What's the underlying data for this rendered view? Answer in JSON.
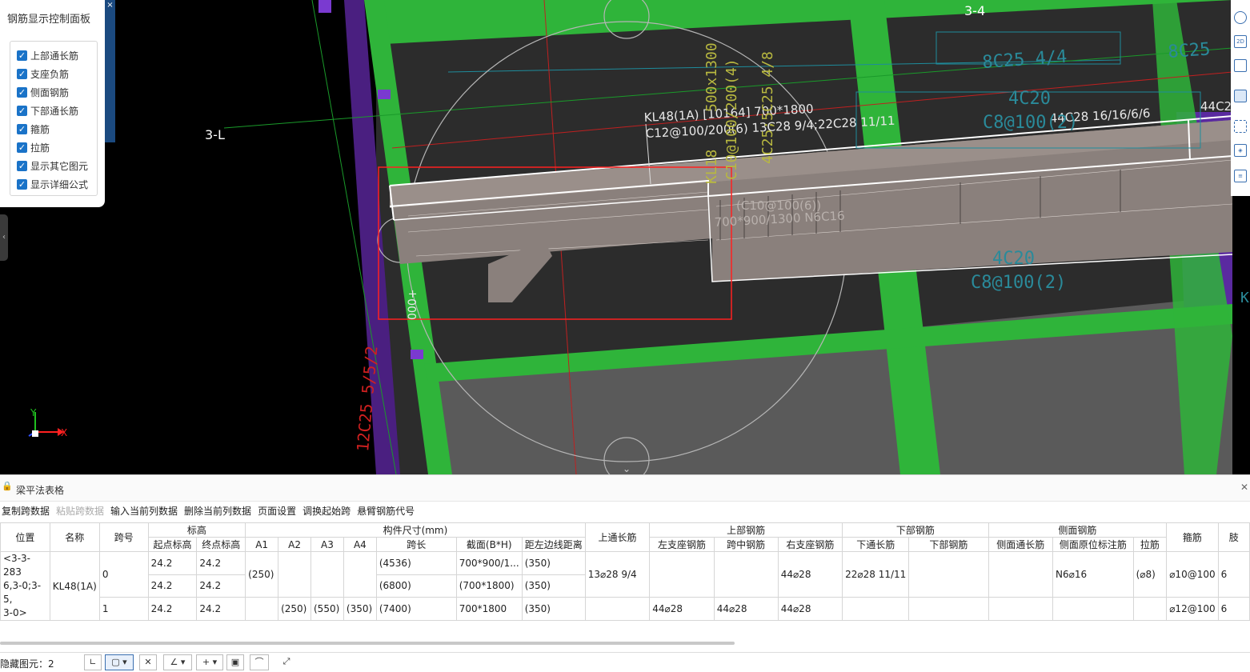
{
  "viewport": {
    "grid_labels": {
      "left_axis": "3-L",
      "top_axis": "3-4"
    },
    "annotations": {
      "beam_name": "KL48(1A) [10164] 700*1800",
      "beam_rebar": "C12@100/200(6) 13C28 9/4;22C28 11/11",
      "rebar_top_right": "8C25 4/4",
      "rebar_top_far": "8C25",
      "count_4c20": "4C20",
      "stirrup_c8_top": "C8@100(2)",
      "rebar_44c28": "44C28 16/16/6/6",
      "rebar_44c2_cut": "44C2",
      "stirrup_inner": "(C10@100(6))",
      "section_inner": "700*900/1300 N6C16",
      "stirrup_c8_bottom": "C8@100(2)",
      "count_4c20_bottom": "4C20",
      "vertical_kl": "KL18",
      "vertical_size": "500x1300",
      "vertical_stirrup": "C10@100/200(4)",
      "vertical_rebar": "4C25;5C25 4/8",
      "rebar_left_side": "12C25 5/5/2",
      "dim_label": "000+",
      "right_edge_char": "K"
    },
    "axes_indicator": {
      "y": "Y",
      "x": "X"
    },
    "colors": {
      "beam_green": "#2fb43a",
      "column_purple": "#6a2bb0",
      "selection_red": "#ff2020",
      "background": "#000000",
      "slab_gray": "#2c2c2c"
    }
  },
  "control_panel": {
    "title": "钢筋显示控制面板",
    "options": [
      {
        "label": "上部通长筋",
        "checked": true
      },
      {
        "label": "支座负筋",
        "checked": true
      },
      {
        "label": "侧面钢筋",
        "checked": true
      },
      {
        "label": "下部通长筋",
        "checked": true
      },
      {
        "label": "箍筋",
        "checked": true
      },
      {
        "label": "拉筋",
        "checked": true
      },
      {
        "label": "显示其它图元",
        "checked": true
      },
      {
        "label": "显示详细公式",
        "checked": true
      }
    ],
    "close_glyph": "×"
  },
  "right_toolbar": {
    "icons": [
      "orbit-icon",
      "2d-view-icon",
      "box-view-icon",
      "cube-view-icon",
      "fit-view-icon",
      "3d-box-icon",
      "formula-icon"
    ],
    "labels": {
      "2d": "2D"
    }
  },
  "table_panel": {
    "title": "梁平法表格",
    "toolbar": [
      {
        "label": "复制跨数据",
        "enabled": true
      },
      {
        "label": "粘贴跨数据",
        "enabled": false
      },
      {
        "label": "输入当前列数据",
        "enabled": true
      },
      {
        "label": "删除当前列数据",
        "enabled": true
      },
      {
        "label": "页面设置",
        "enabled": true
      },
      {
        "label": "调换起始跨",
        "enabled": true
      },
      {
        "label": "悬臂钢筋代号",
        "enabled": true
      }
    ],
    "headers": {
      "position": "位置",
      "name": "名称",
      "span_no": "跨号",
      "elevation": "标高",
      "elev_start": "起点标高",
      "elev_end": "终点标高",
      "dimensions": "构件尺寸(mm)",
      "a1": "A1",
      "a2": "A2",
      "a3": "A3",
      "a4": "A4",
      "span_len": "跨长",
      "section": "截面(B*H)",
      "edge_dist": "距左边线距离",
      "top_cont": "上通长筋",
      "top_rebar": "上部钢筋",
      "left_support": "左支座钢筋",
      "mid_span": "跨中钢筋",
      "right_support": "右支座钢筋",
      "bottom_rebar": "下部钢筋",
      "bottom_cont": "下通长筋",
      "bottom_bar": "下部钢筋",
      "side_rebar": "侧面钢筋",
      "side_cont": "侧面通长筋",
      "side_orig": "侧面原位标注筋",
      "tie": "拉筋",
      "stirrup": "箍筋",
      "limbs": "肢"
    },
    "rows": [
      {
        "position": "<3-3-283\n6,3-0;3-5,\n3-0>",
        "name": "KL48(1A)",
        "span": "0",
        "elev_start": "24.2",
        "elev_end": "24.2",
        "a1": "(250)",
        "a2": "",
        "a3": "",
        "a4": "",
        "span_len": "(4536)",
        "section": "700*900/1...",
        "edge_dist": "(350)",
        "top_cont": "13⌀28 9/4",
        "left_support": "",
        "mid_span": "",
        "right_support": "44⌀28",
        "bottom_cont": "22⌀28 11/11",
        "bottom_bar": "",
        "side_cont": "",
        "side_orig": "N6⌀16",
        "tie": "(⌀8)",
        "stirrup": "⌀10@100",
        "limbs": "6"
      },
      {
        "elev_start": "24.2",
        "elev_end": "24.2",
        "span_len": "(6800)",
        "section": "(700*1800)",
        "edge_dist": "(350)"
      },
      {
        "span": "1",
        "elev_start": "24.2",
        "elev_end": "24.2",
        "a1": "",
        "a2": "(250)",
        "a3": "(550)",
        "a4": "(350)",
        "span_len": "(7400)",
        "section": "700*1800",
        "edge_dist": "(350)",
        "top_cont": "",
        "left_support": "44⌀28",
        "mid_span": "44⌀28",
        "right_support": "44⌀28",
        "bottom_cont": "",
        "bottom_bar": "",
        "side_cont": "",
        "side_orig": "",
        "tie": "",
        "stirrup": "⌀12@100",
        "limbs": "6"
      }
    ]
  },
  "status_bar": {
    "hidden_label": "隐藏图元：2"
  }
}
